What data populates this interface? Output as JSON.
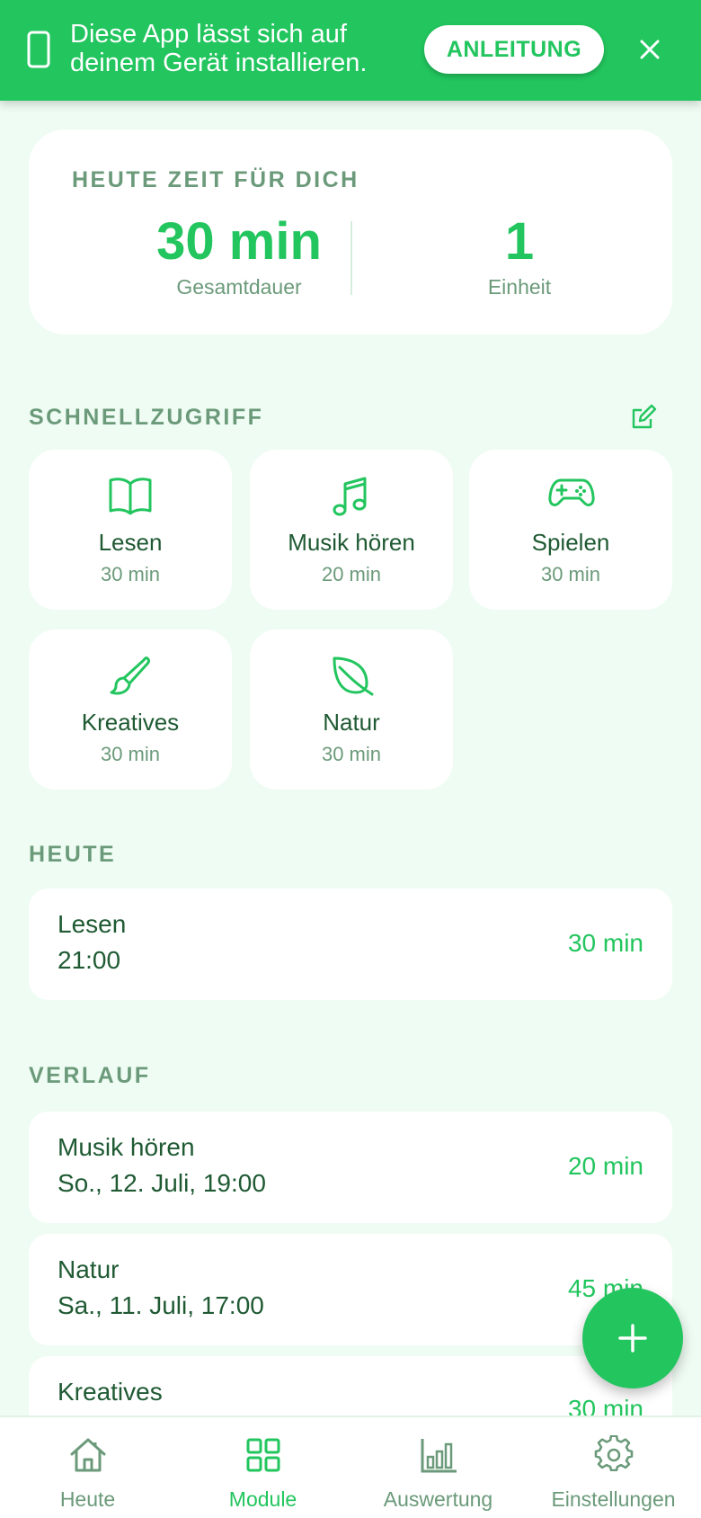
{
  "banner": {
    "text": "Diese App lässt sich auf deinem Gerät installieren.",
    "button_label": "ANLEITUNG",
    "icons": [
      "phone-icon",
      "close-icon"
    ]
  },
  "summary": {
    "heading": "HEUTE ZEIT FÜR DICH",
    "total_value": "30 min",
    "total_label": "Gesamtdauer",
    "units_value": "1",
    "units_label": "Einheit"
  },
  "quick_access": {
    "heading": "SCHNELLZUGRIFF",
    "tiles": [
      {
        "name": "Lesen",
        "duration": "30 min",
        "icon": "book-icon"
      },
      {
        "name": "Musik hören",
        "duration": "20 min",
        "icon": "music-note-icon"
      },
      {
        "name": "Spielen",
        "duration": "30 min",
        "icon": "gamepad-icon"
      },
      {
        "name": "Kreatives",
        "duration": "30 min",
        "icon": "paintbrush-icon"
      },
      {
        "name": "Natur",
        "duration": "30 min",
        "icon": "leaf-icon"
      }
    ]
  },
  "today": {
    "heading": "HEUTE",
    "entries": [
      {
        "title": "Lesen",
        "time": "21:00",
        "duration": "30 min"
      }
    ]
  },
  "history": {
    "heading": "VERLAUF",
    "entries": [
      {
        "title": "Musik hören",
        "time": "So., 12. Juli, 19:00",
        "duration": "20 min"
      },
      {
        "title": "Natur",
        "time": "Sa., 11. Juli, 17:00",
        "duration": "45 min"
      },
      {
        "title": "Kreatives",
        "time": "",
        "duration": "30 min"
      }
    ]
  },
  "nav": {
    "items": [
      {
        "label": "Heute",
        "icon": "home-icon"
      },
      {
        "label": "Module",
        "icon": "grid-icon",
        "active": true
      },
      {
        "label": "Auswertung",
        "icon": "bar-chart-icon"
      },
      {
        "label": "Einstellungen",
        "icon": "gear-icon"
      }
    ]
  },
  "colors": {
    "accent": "#22c55e",
    "background": "#effcf3",
    "text": "#1f5a33",
    "muted": "#6b9a7a"
  }
}
